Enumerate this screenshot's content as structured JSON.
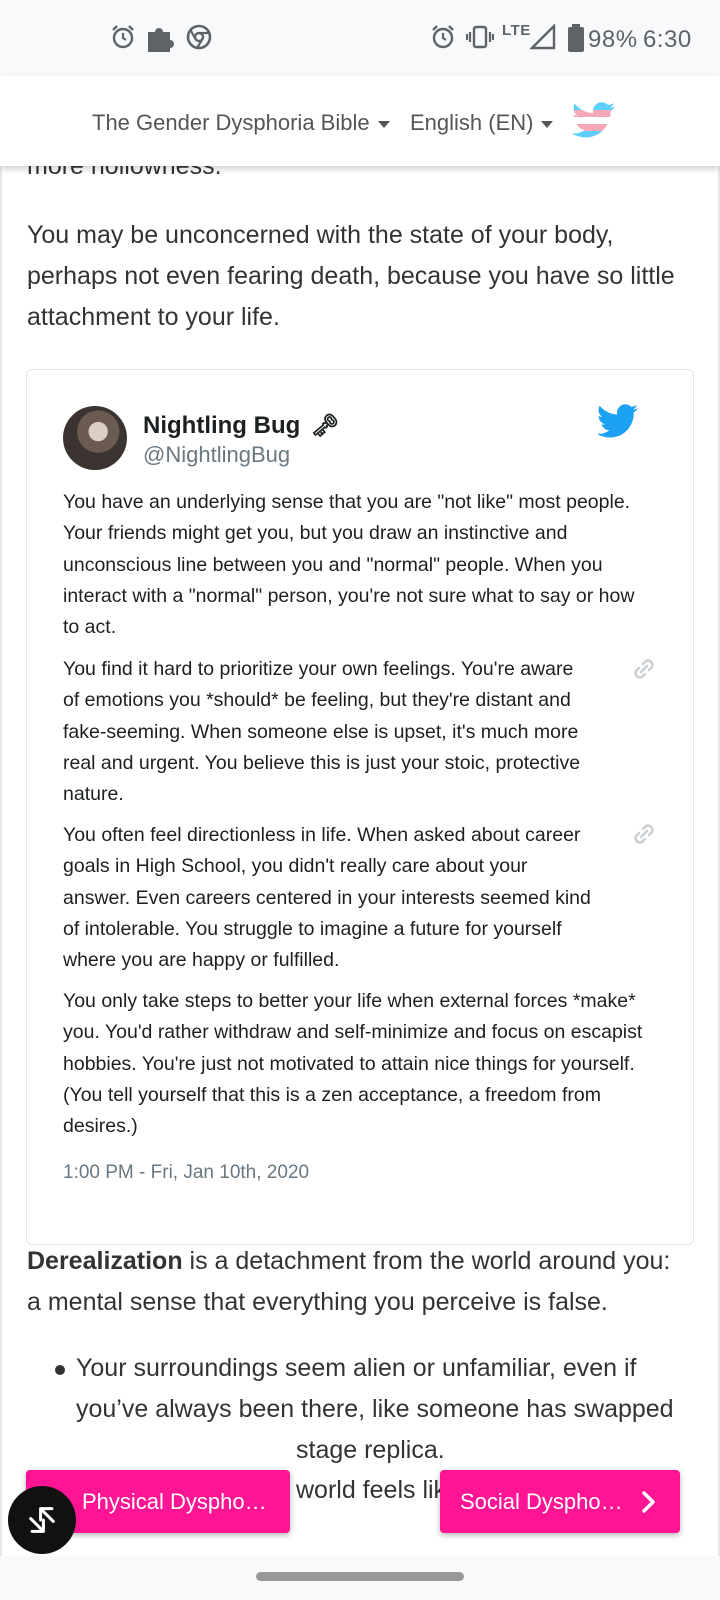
{
  "status_bar": {
    "battery": "98%",
    "time": "6:30",
    "network": "LTE",
    "icons": [
      "alarm-icon",
      "puzzle-icon",
      "chrome-icon",
      "alarm-icon",
      "vibrate-icon",
      "signal-icon",
      "battery-icon"
    ]
  },
  "nav": {
    "book_menu": "The Gender Dysphoria Bible",
    "language_menu": "English (EN)",
    "twitter_icon": "twitter-trans-flag-icon",
    "flag_colors": [
      "#5bcefa",
      "#f5a9b8",
      "#ffffff"
    ]
  },
  "content": {
    "cut_line": "more hollowness.",
    "para1": "You may be unconcerned with the state of your body, perhaps not even fearing death, because you have so little attachment to your life.",
    "tweet": {
      "name": "Nightling Bug",
      "name_emoji": "🗝",
      "handle": "@NightlingBug",
      "paragraphs": [
        "You have an underlying sense that you are \"not like\" most people. Your friends might get you, but you draw an instinctive and unconscious line between you and \"normal\" people. When you interact with a \"normal\" person, you're not sure what to say or how to act.",
        "You find it hard to prioritize your own feelings. You're aware of emotions you *should* be feeling, but they're distant and fake-seeming. When someone else is upset, it's much more real and urgent. You believe this is just your stoic, protective nature.",
        "You often feel directionless in life. When asked about career goals in High School, you didn't really care about your answer. Even careers centered in your interests seemed kind of intolerable. You struggle to imagine a future for yourself where you are happy or fulfilled.",
        "You only take steps to better your life when external forces *make* you. You'd rather withdraw and self-minimize and focus on escapist hobbies. You're just not motivated to attain nice things for yourself. (You tell yourself that this is a zen acceptance, a freedom from desires.)"
      ],
      "date": "1:00 PM - Fri, Jan 10th, 2020"
    },
    "derealization_term": "Derealization",
    "derealization_rest": " is a detachment from the world around you: a mental sense that everything you perceive is false.",
    "bullets": [
      "Your surroundings seem alien or unfamiliar, even if you’ve always been there, like someone has swapped them out with a stage replica.",
      "Walking through the world feels like you are on a treadmill, with the buildings moving around you instead"
    ],
    "visible_bullet_lines": [
      "Your surroundings seem alien or unfamiliar, even if",
      "you’ve always been there, like someone has swapped",
      "stage replica.",
      "world feels lik"
    ]
  },
  "footer": {
    "prev_label": "Physical Dyspho…",
    "next_label": "Social Dyspho…",
    "accent_color": "#ff1493"
  }
}
